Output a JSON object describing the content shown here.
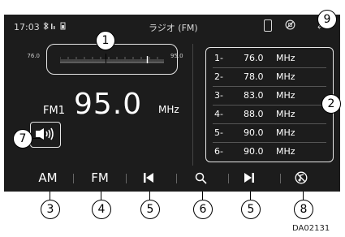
{
  "status_bar": {
    "time": "17:03",
    "title": "ラジオ (FM)",
    "back_glyph": "⤶"
  },
  "tuner": {
    "low_label": "76.0",
    "high_label": "95.0",
    "position": 0.84
  },
  "now_playing": {
    "band": "FM1",
    "frequency": "95.0",
    "unit": "MHz"
  },
  "presets": [
    {
      "number": "1-",
      "frequency": "76.0",
      "unit": "MHz"
    },
    {
      "number": "2-",
      "frequency": "78.0",
      "unit": "MHz"
    },
    {
      "number": "3-",
      "frequency": "83.0",
      "unit": "MHz"
    },
    {
      "number": "4-",
      "frequency": "88.0",
      "unit": "MHz"
    },
    {
      "number": "5-",
      "frequency": "90.0",
      "unit": "MHz"
    },
    {
      "number": "6-",
      "frequency": "90.0",
      "unit": "MHz"
    }
  ],
  "bottom_bar": {
    "am_label": "AM",
    "fm_label": "FM"
  },
  "callouts": {
    "c1": "1",
    "c2": "2",
    "c3": "3",
    "c4": "4",
    "c5a": "5",
    "c6": "6",
    "c5b": "5",
    "c7": "7",
    "c8": "8",
    "c9": "9"
  },
  "figure_code": "DA02131",
  "colors": {
    "screen_bg": "#1c1c1c",
    "text": "#ffffff",
    "outline": "#e6e6e6"
  }
}
